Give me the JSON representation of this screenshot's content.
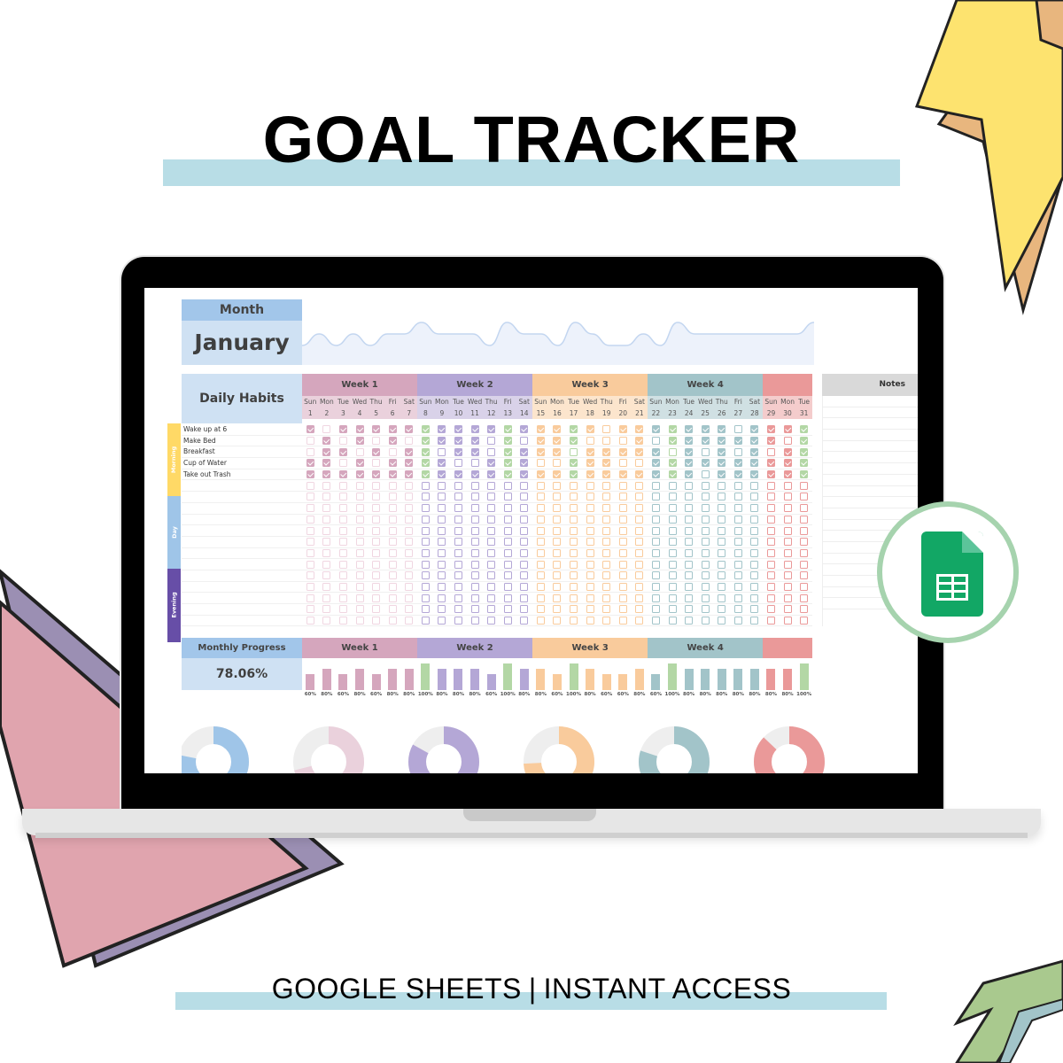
{
  "page": {
    "title": "GOAL TRACKER",
    "footer_left": "GOOGLE SHEETS",
    "footer_sep": "|",
    "footer_right": "INSTANT ACCESS"
  },
  "colors": {
    "title_band": "#b8dde6",
    "complete_green": "#b3d7a5",
    "sheets_green": "#12a765",
    "header_blue": "#a2c6ea",
    "cell_blue": "#cfe1f3",
    "monthly_donut": "#9fc5e8"
  },
  "sheet": {
    "month_label": "Month",
    "month_value": "January",
    "daily_habits_label": "Daily Habits",
    "notes_label": "Notes",
    "monthly_progress_label": "Monthly Progress",
    "monthly_progress_value": "78.06%",
    "sections": [
      {
        "label": "Morning",
        "color": "#ffd966"
      },
      {
        "label": "Day",
        "color": "#9fc5e8"
      },
      {
        "label": "Evening",
        "color": "#674ea7"
      }
    ],
    "weeks": [
      {
        "label": "Week 1",
        "head": "#d5a6bd",
        "sub": "#ead1dc",
        "box": "#d5a6bd",
        "empty": "#f0d6e1",
        "donut": "#ead1dc",
        "donut_pct": 71
      },
      {
        "label": "Week 2",
        "head": "#b4a7d6",
        "sub": "#d9d2e9",
        "box": "#b4a7d6",
        "empty": "#b4a7d6",
        "donut": "#b4a7d6",
        "donut_pct": 83
      },
      {
        "label": "Week 3",
        "head": "#f9cb9c",
        "sub": "#fce5cd",
        "box": "#f9cb9c",
        "empty": "#f9cb9c",
        "donut": "#f9cb9c",
        "donut_pct": 74
      },
      {
        "label": "Week 4",
        "head": "#a2c4c9",
        "sub": "#d0e0e3",
        "box": "#a2c4c9",
        "empty": "#a2c4c9",
        "donut": "#a2c4c9",
        "donut_pct": 80
      },
      {
        "label": "",
        "head": "#ea9999",
        "sub": "#f4cccc",
        "box": "#ea9999",
        "empty": "#ea9999",
        "donut": "#ea9999",
        "donut_pct": 87
      }
    ],
    "monthly_donut_pct": 78,
    "days": [
      {
        "name": "Sun",
        "num": "1"
      },
      {
        "name": "Mon",
        "num": "2"
      },
      {
        "name": "Tue",
        "num": "3"
      },
      {
        "name": "Wed",
        "num": "4"
      },
      {
        "name": "Thu",
        "num": "5"
      },
      {
        "name": "Fri",
        "num": "6"
      },
      {
        "name": "Sat",
        "num": "7"
      },
      {
        "name": "Sun",
        "num": "8"
      },
      {
        "name": "Mon",
        "num": "9"
      },
      {
        "name": "Tue",
        "num": "10"
      },
      {
        "name": "Wed",
        "num": "11"
      },
      {
        "name": "Thu",
        "num": "12"
      },
      {
        "name": "Fri",
        "num": "13"
      },
      {
        "name": "Sat",
        "num": "14"
      },
      {
        "name": "Sun",
        "num": "15"
      },
      {
        "name": "Mon",
        "num": "16"
      },
      {
        "name": "Tue",
        "num": "17"
      },
      {
        "name": "Wed",
        "num": "18"
      },
      {
        "name": "Thu",
        "num": "19"
      },
      {
        "name": "Fri",
        "num": "20"
      },
      {
        "name": "Sat",
        "num": "21"
      },
      {
        "name": "Sun",
        "num": "22"
      },
      {
        "name": "Mon",
        "num": "23"
      },
      {
        "name": "Tue",
        "num": "24"
      },
      {
        "name": "Wed",
        "num": "25"
      },
      {
        "name": "Thu",
        "num": "26"
      },
      {
        "name": "Fri",
        "num": "27"
      },
      {
        "name": "Sat",
        "num": "28"
      },
      {
        "name": "Sun",
        "num": "29"
      },
      {
        "name": "Mon",
        "num": "30"
      },
      {
        "name": "Tue",
        "num": "31"
      }
    ],
    "habits": [
      {
        "label": "Wake up at 6",
        "checks": "1011111"
      },
      {
        "label": "Make Bed",
        "checks": ""
      },
      {
        "label": "Breakfast",
        "checks": ""
      },
      {
        "label": "Cup of Water",
        "checks": ""
      },
      {
        "label": "Take out Trash",
        "checks": ""
      }
    ],
    "checks": [
      "1011111",
      "0101010",
      "0110101",
      "1101011",
      "1111111"
    ],
    "checks_full": [
      "1011111111111111110111111101111",
      "0101010111101011100010111111101",
      "0110101101101111011111010101011",
      "1101011110011100111001111111111",
      "1111111111111111111111110111111"
    ],
    "blank_rows": 13,
    "daily_pct": [
      60,
      80,
      60,
      80,
      60,
      80,
      80,
      100,
      80,
      80,
      80,
      60,
      100,
      80,
      80,
      60,
      100,
      80,
      60,
      60,
      80,
      60,
      100,
      80,
      80,
      80,
      80,
      80,
      80,
      80,
      100
    ],
    "daily_pct_labels": [
      "60%",
      "80%",
      "60%",
      "80%",
      "60%",
      "80%",
      "80%",
      "100%",
      "80%",
      "80%",
      "80%",
      "60%",
      "100%",
      "80%",
      "80%",
      "60%",
      "100%",
      "80%",
      "60%",
      "60%",
      "80%",
      "60%",
      "100%",
      "80%",
      "80%",
      "80%",
      "80%",
      "80%",
      "80%",
      "80%",
      "100%"
    ]
  }
}
